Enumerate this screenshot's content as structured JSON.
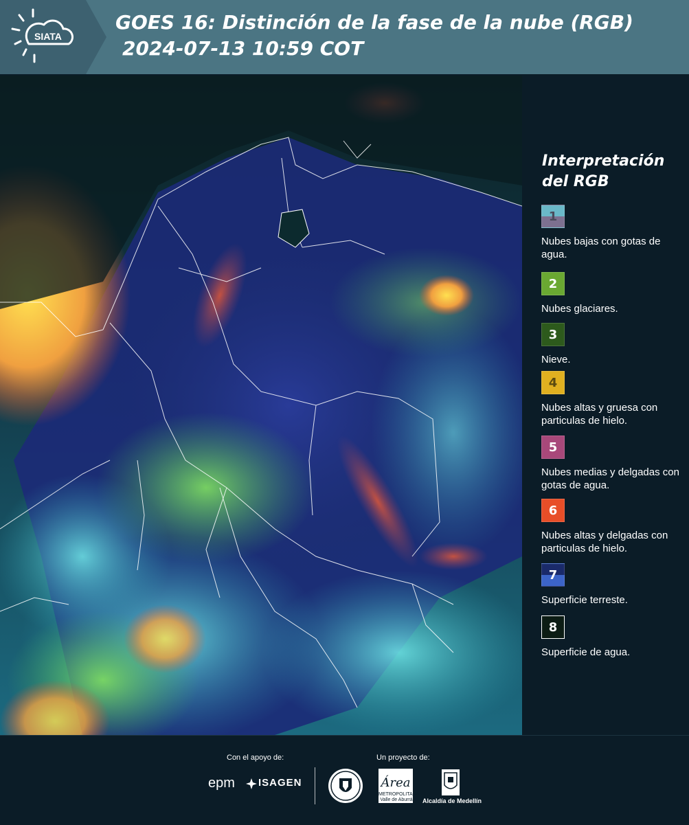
{
  "header": {
    "logo_text": "SIATA",
    "title_line1": "GOES 16: Distinción de la fase de la nube (RGB)",
    "title_line2": "2024-07-13 10:59 COT"
  },
  "legend": {
    "title_line1": "Interpretación",
    "title_line2": "del RGB",
    "items": [
      {
        "num": "1",
        "label": "Nubes bajas con gotas de agua.",
        "color_top": "#6ab8c8",
        "color_bottom": "#7d7090",
        "text_color": "#4a4a5a"
      },
      {
        "num": "2",
        "label": "Nubes glaciares.",
        "color_top": "#6aa832",
        "color_bottom": "#6aa832",
        "text_color": "#ffffff"
      },
      {
        "num": "3",
        "label": "Nieve.",
        "color_top": "#2d5a1c",
        "color_bottom": "#2d5a1c",
        "text_color": "#ffffff"
      },
      {
        "num": "4",
        "label": "Nubes altas y gruesa con particulas de hielo.",
        "color_top": "#e0b020",
        "color_bottom": "#e0b020",
        "text_color": "#5a4a10"
      },
      {
        "num": "5",
        "label": "Nubes medias y delgadas con gotas de agua.",
        "color_top": "#a8487a",
        "color_bottom": "#a8487a",
        "text_color": "#ffffff"
      },
      {
        "num": "6",
        "label": "Nubes altas y delgadas con particulas de hielo.",
        "color_top": "#e84e28",
        "color_bottom": "#e84e28",
        "text_color": "#ffffff"
      },
      {
        "num": "7",
        "label": "Superficie terreste.",
        "color_top": "#1a2a6a",
        "color_bottom": "#3c64c8",
        "text_color": "#ffffff"
      },
      {
        "num": "8",
        "label": "Superficie de agua.",
        "color_top": "#0c1c14",
        "color_bottom": "#0c1c14",
        "text_color": "#ffffff"
      }
    ]
  },
  "footer": {
    "support_label": "Con el apoyo de:",
    "project_label": "Un proyecto de:",
    "epm": "epm",
    "isagen": "ISAGEN",
    "area_text": "METROPOLITANA Valle de Aburrá",
    "area_word": "Área",
    "medellin": "Alcaldía de Medellín"
  },
  "colors": {
    "header_bg": "#4b7583",
    "panel_bg": "#0b1c27"
  }
}
